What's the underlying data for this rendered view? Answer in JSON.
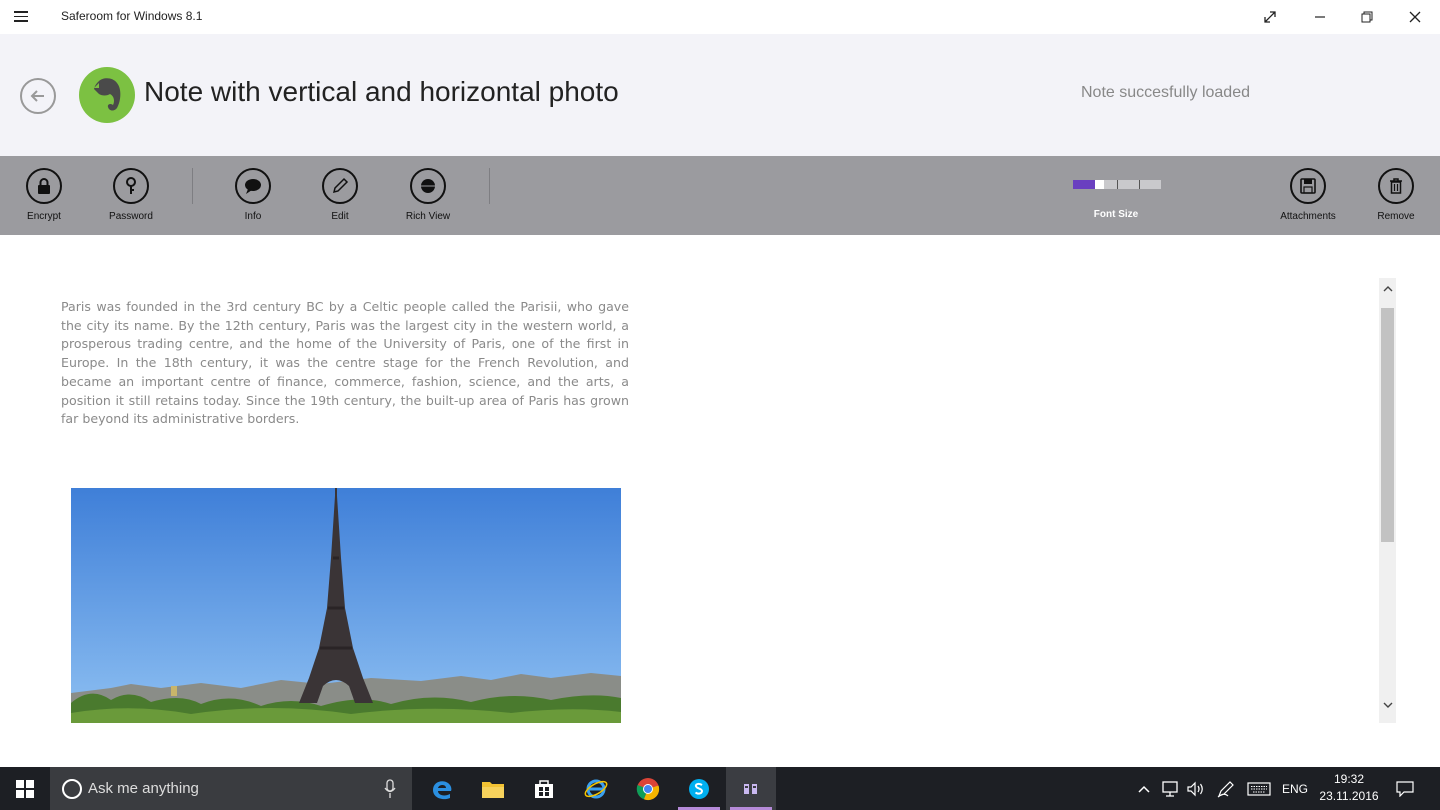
{
  "window": {
    "title": "Saferoom for Windows 8.1",
    "controls": [
      "full-screen",
      "minimize",
      "restore",
      "close"
    ]
  },
  "header": {
    "note_title": "Note with vertical and horizontal photo",
    "status": "Note succesfully loaded"
  },
  "toolbar": {
    "left_items": [
      {
        "label": "Encrypt",
        "icon": "lock-icon"
      },
      {
        "label": "Password",
        "icon": "key-icon"
      },
      {
        "label": "Info",
        "icon": "speech-bubble-icon"
      },
      {
        "label": "Edit",
        "icon": "pencil-icon"
      },
      {
        "label": "Rich View",
        "icon": "dot-icon"
      }
    ],
    "font_size": {
      "label": "Font Size",
      "level": 2,
      "steps": 4
    },
    "right_items": [
      {
        "label": "Attachments",
        "icon": "floppy-icon"
      },
      {
        "label": "Remove",
        "icon": "trash-icon"
      }
    ]
  },
  "note": {
    "body": "Paris was founded in the 3rd century BC by a Celtic people called the Parisii, who gave the city its name. By the 12th century, Paris was the largest city in the western world, a prosperous trading centre, and the home of the University of Paris, one of the first in Europe. In the 18th century, it was the centre stage for the French Revolution, and became an important centre of finance, commerce, fashion, science, and the arts, a position it still retains today. Since the 19th century, the built-up area of Paris has grown far beyond its administrative borders."
  },
  "taskbar": {
    "search_placeholder": "Ask me anything",
    "language": "ENG",
    "time": "19:32",
    "date": "23.11.2016"
  },
  "colors": {
    "toolbar_bg": "#9b9b9f",
    "header_bg": "#f3f3f8",
    "accent_purple": "#6a3fc0",
    "evernote_green": "#7cc142"
  }
}
